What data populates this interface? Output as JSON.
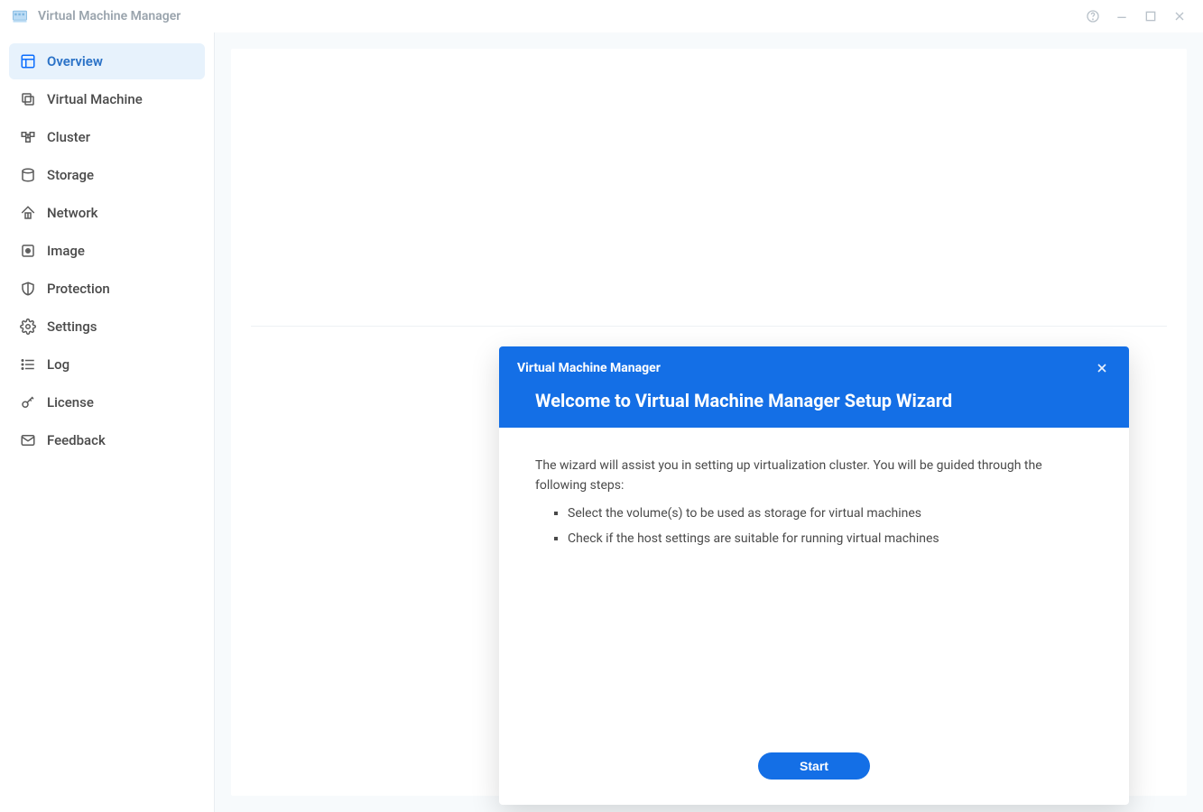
{
  "titlebar": {
    "title": "Virtual Machine Manager"
  },
  "sidebar": {
    "items": [
      {
        "label": "Overview"
      },
      {
        "label": "Virtual Machine"
      },
      {
        "label": "Cluster"
      },
      {
        "label": "Storage"
      },
      {
        "label": "Network"
      },
      {
        "label": "Image"
      },
      {
        "label": "Protection"
      },
      {
        "label": "Settings"
      },
      {
        "label": "Log"
      },
      {
        "label": "License"
      },
      {
        "label": "Feedback"
      }
    ]
  },
  "wizard": {
    "subtitle": "Virtual Machine Manager",
    "title": "Welcome to Virtual Machine Manager Setup Wizard",
    "intro": "The wizard will assist you in setting up virtualization cluster. You will be guided through the following steps:",
    "steps": [
      "Select the volume(s) to be used as storage for virtual machines",
      "Check if the host settings are suitable for running virtual machines"
    ],
    "start_label": "Start"
  }
}
